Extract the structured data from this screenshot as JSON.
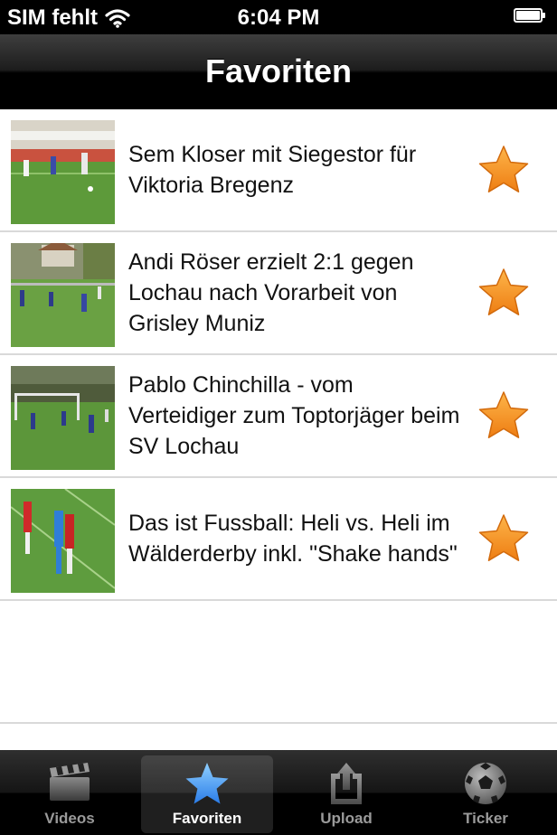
{
  "status_bar": {
    "carrier": "SIM fehlt",
    "time": "6:04 PM"
  },
  "nav": {
    "title": "Favoriten"
  },
  "favorites": [
    {
      "title": "Sem Kloser mit Siegestor für Viktoria Bregenz",
      "thumbnail_icon": "soccer-match-thumbnail"
    },
    {
      "title": "Andi Röser erzielt 2:1 gegen Lochau nach Vorarbeit von Grisley Muniz",
      "thumbnail_icon": "soccer-match-thumbnail"
    },
    {
      "title": "Pablo Chinchilla - vom Verteidiger zum Toptorjäger beim SV Lochau",
      "thumbnail_icon": "soccer-match-thumbnail"
    },
    {
      "title": "Das ist Fussball: Heli vs. Heli im Wälderderby inkl. \"Shake hands\"",
      "thumbnail_icon": "soccer-match-thumbnail"
    }
  ],
  "tabs": [
    {
      "label": "Videos",
      "icon": "clapperboard-icon",
      "active": false
    },
    {
      "label": "Favoriten",
      "icon": "star-icon",
      "active": true
    },
    {
      "label": "Upload",
      "icon": "upload-icon",
      "active": false
    },
    {
      "label": "Ticker",
      "icon": "soccer-ball-icon",
      "active": false
    }
  ],
  "colors": {
    "favorite_star": "#f7941d",
    "tab_active_star": "#4a9ff5"
  }
}
